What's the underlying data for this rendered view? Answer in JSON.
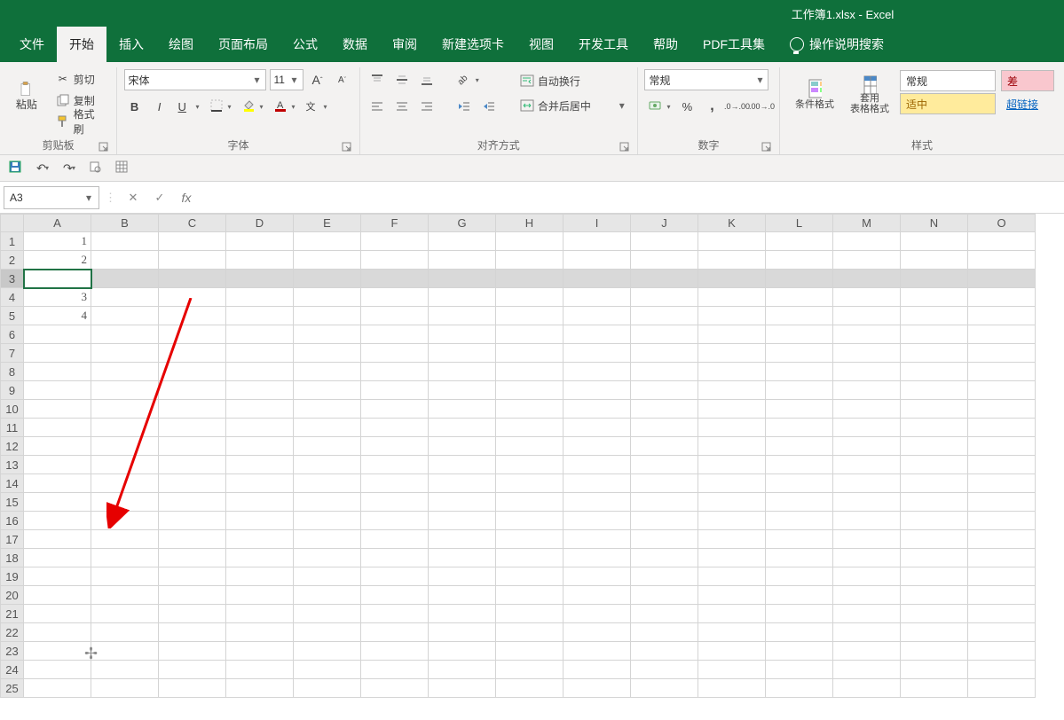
{
  "title": "工作簿1.xlsx - Excel",
  "tabs": [
    "文件",
    "开始",
    "插入",
    "绘图",
    "页面布局",
    "公式",
    "数据",
    "审阅",
    "新建选项卡",
    "视图",
    "开发工具",
    "帮助",
    "PDF工具集"
  ],
  "active_tab_index": 1,
  "tell_me": "操作说明搜索",
  "clipboard": {
    "paste": "粘贴",
    "cut": "剪切",
    "copy": "复制",
    "format_painter": "格式刷",
    "label": "剪贴板"
  },
  "font": {
    "name": "宋体",
    "size": "11",
    "label": "字体",
    "bold": "B",
    "italic": "I",
    "underline": "U"
  },
  "align": {
    "label": "对齐方式",
    "wrap": "自动换行",
    "merge": "合并后居中"
  },
  "number": {
    "label": "数字",
    "format": "常规",
    "percent": "%",
    "comma": ","
  },
  "styles": {
    "cond": "条件格式",
    "table": "套用\n表格格式",
    "label": "样式",
    "cell_normal": "常规",
    "cell_good": "适中",
    "cell_bad": "差",
    "cell_link": "超链接"
  },
  "namebox": "A3",
  "columns": [
    "A",
    "B",
    "C",
    "D",
    "E",
    "F",
    "G",
    "H",
    "I",
    "J",
    "K",
    "L",
    "M",
    "N",
    "O"
  ],
  "rows": 25,
  "selected_row": 3,
  "cells": {
    "A1": "1",
    "A2": "2",
    "A4": "3",
    "A5": "4"
  }
}
